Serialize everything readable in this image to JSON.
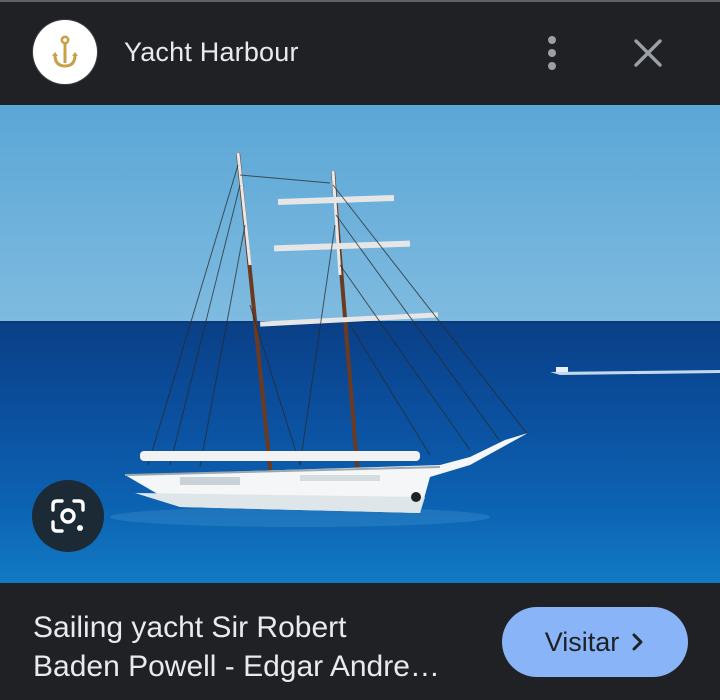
{
  "header": {
    "site_name": "Yacht Harbour",
    "logo_icon": "anchor-icon",
    "menu_icon": "more-vert-icon",
    "close_icon": "close-icon"
  },
  "image": {
    "lens_icon": "google-lens-icon"
  },
  "footer": {
    "caption_line1": "Sailing yacht Sir Robert",
    "caption_line2": "Baden Powell - Edgar Andre…",
    "visit_label": "Visitar",
    "visit_icon": "chevron-right-icon"
  },
  "colors": {
    "background": "#202124",
    "text": "#e8eaed",
    "button": "#8ab4f8",
    "logo_accent": "#c9a04a"
  }
}
